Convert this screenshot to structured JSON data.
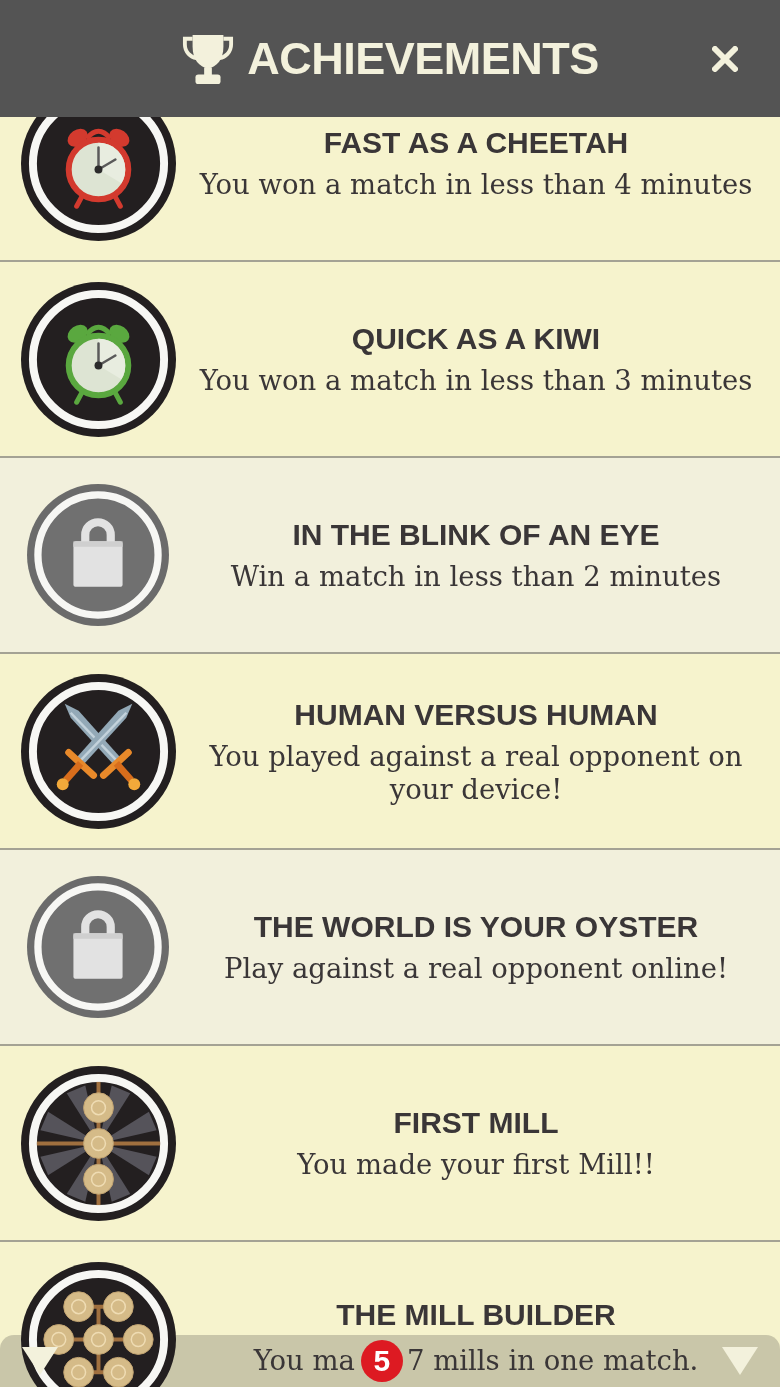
{
  "header": {
    "title": "ACHIEVEMENTS"
  },
  "achievements": [
    {
      "title": "FAST AS A CHEETAH",
      "description": "You won a match in less than 4 minutes",
      "locked": false,
      "kind": "clock",
      "color": "#d33a2e"
    },
    {
      "title": "QUICK AS A KIWI",
      "description": "You won a match in less than 3 minutes",
      "locked": false,
      "kind": "clock",
      "color": "#5aa83f"
    },
    {
      "title": "IN THE BLINK OF AN EYE",
      "description": "Win a match in less than 2 minutes",
      "locked": true,
      "kind": "lock"
    },
    {
      "title": "HUMAN VERSUS HUMAN",
      "description": "You played against a real opponent on your device!",
      "locked": false,
      "kind": "swords"
    },
    {
      "title": "THE WORLD IS YOUR OYSTER",
      "description": "Play against a real opponent online!",
      "locked": true,
      "kind": "lock"
    },
    {
      "title": "FIRST MILL",
      "description": "You made your first Mill!!",
      "locked": false,
      "kind": "mill"
    },
    {
      "title": "THE MILL BUILDER",
      "description_parts": [
        "You ma",
        "7 mills in one match."
      ],
      "locked": false,
      "kind": "mills"
    }
  ],
  "bottom_bar": {
    "badge": "5"
  }
}
